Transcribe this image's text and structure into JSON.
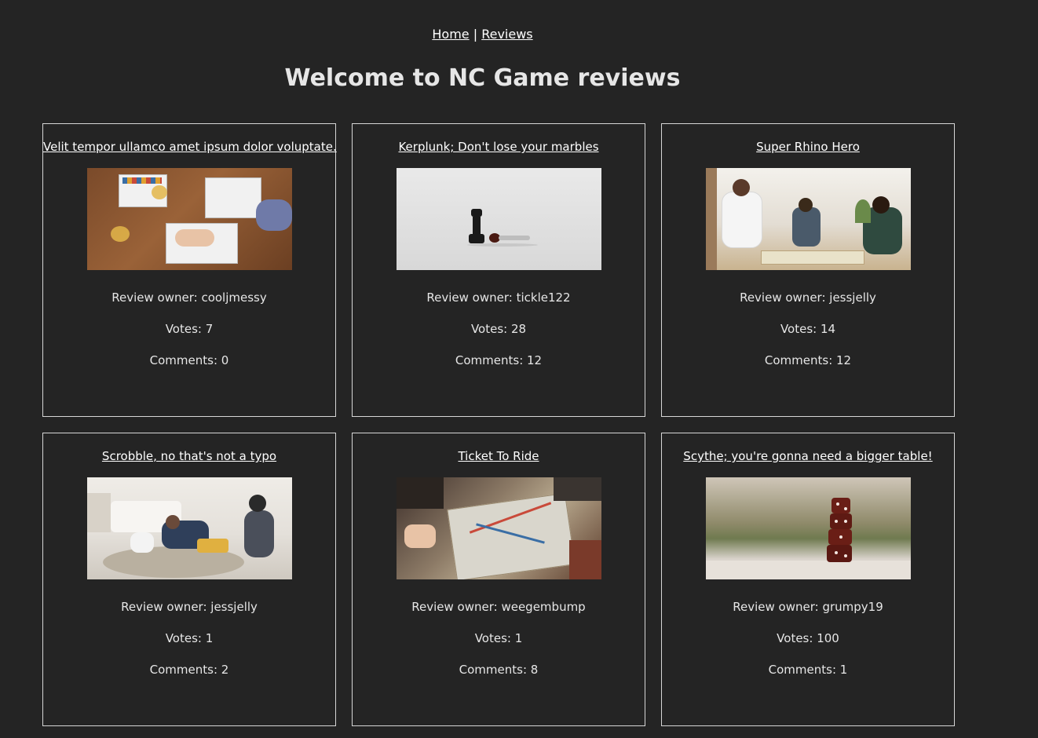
{
  "nav": {
    "home_label": "Home",
    "separator": "|",
    "reviews_label": "Reviews"
  },
  "page_title": "Welcome to NC Game reviews",
  "labels": {
    "owner_prefix": "Review owner: ",
    "votes_prefix": "Votes: ",
    "comments_prefix": "Comments: "
  },
  "reviews": [
    {
      "title": "Velit tempor ullamco amet ipsum dolor voluptate.",
      "image": "players-at-wooden-table-photo",
      "owner": "cooljmessy",
      "votes": "7",
      "comments": "0",
      "owner_line": "Review owner: cooljmessy",
      "votes_line": "Votes: 7",
      "comments_line": "Comments: 0"
    },
    {
      "title": "Kerplunk; Don't lose your marbles",
      "image": "chess-pieces-photo",
      "owner": "tickle122",
      "votes": "28",
      "comments": "12",
      "owner_line": "Review owner: tickle122",
      "votes_line": "Votes: 28",
      "comments_line": "Comments: 12"
    },
    {
      "title": "Super Rhino Hero",
      "image": "family-playing-on-floor-photo",
      "owner": "jessjelly",
      "votes": "14",
      "comments": "12",
      "owner_line": "Review owner: jessjelly",
      "votes_line": "Votes: 14",
      "comments_line": "Comments: 12"
    },
    {
      "title": "Scrobble, no that's not a typo",
      "image": "family-playing-on-rug-photo",
      "owner": "jessjelly",
      "votes": "1",
      "comments": "2",
      "owner_line": "Review owner: jessjelly",
      "votes_line": "Votes: 1",
      "comments_line": "Comments: 2"
    },
    {
      "title": "Ticket To Ride",
      "image": "board-game-on-floor-photo",
      "owner": "weegembump",
      "votes": "1",
      "comments": "8",
      "owner_line": "Review owner: weegembump",
      "votes_line": "Votes: 1",
      "comments_line": "Comments: 8"
    },
    {
      "title": "Scythe; you're gonna need a bigger table!",
      "image": "stacked-dice-photo",
      "owner": "grumpy19",
      "votes": "100",
      "comments": "1",
      "owner_line": "Review owner: grumpy19",
      "votes_line": "Votes: 100",
      "comments_line": "Comments: 1"
    }
  ]
}
